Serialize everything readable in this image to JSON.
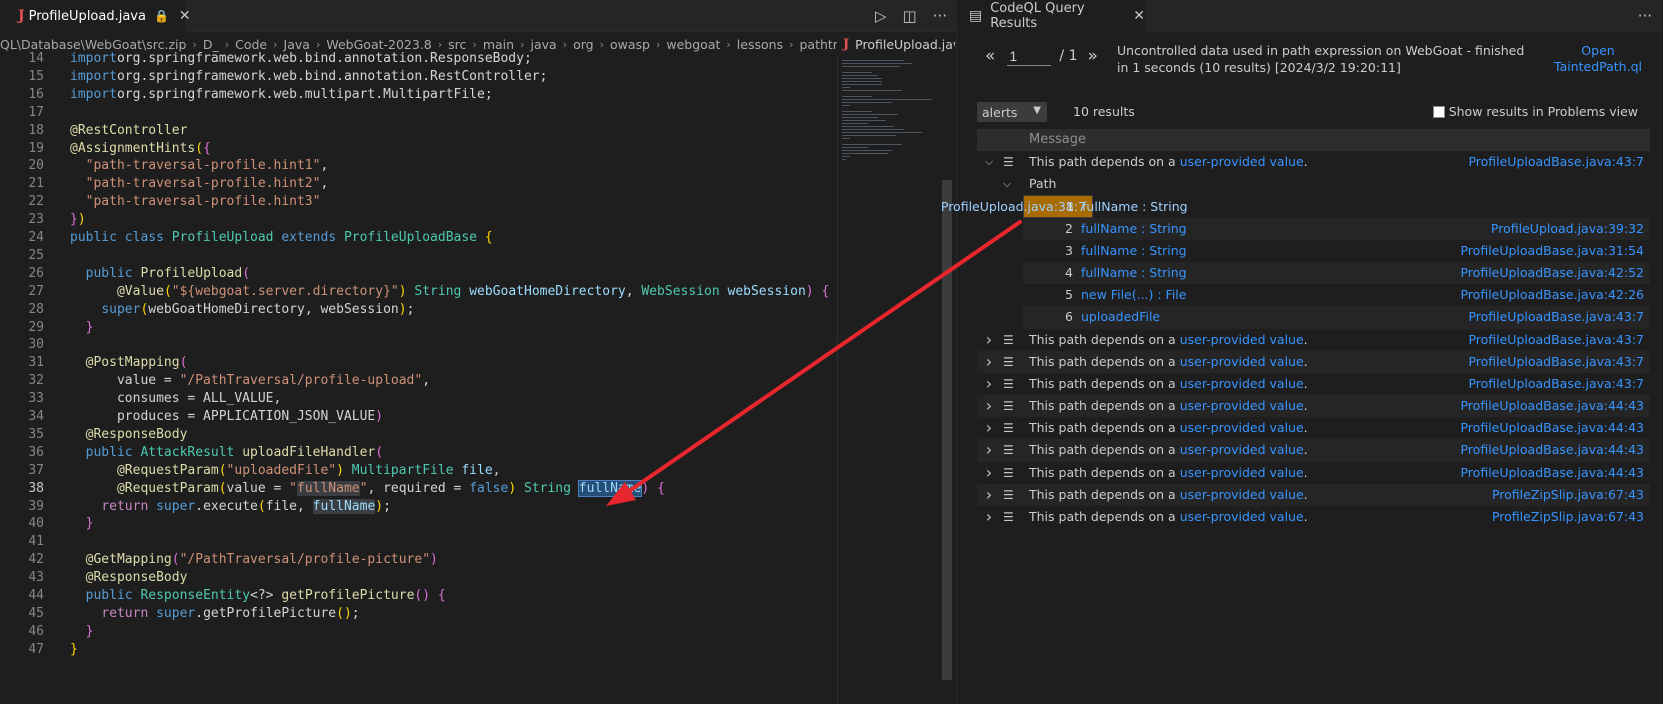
{
  "editor": {
    "tab": {
      "icon": "J",
      "name": "ProfileUpload.java"
    },
    "breadcrumb": [
      "QL\\Database\\WebGoat\\src.zip",
      "D_",
      "Code",
      "Java",
      "WebGoat-2023.8",
      "src",
      "main",
      "java",
      "org",
      "owasp",
      "webgoat",
      "lessons",
      "pathtraversal"
    ],
    "minimap_tab": {
      "icon": "J",
      "name": "ProfileUpload.java"
    },
    "active_line": "38",
    "lines": [
      {
        "n": "14",
        "code": [
          [
            "kw",
            "import"
          ],
          [
            "",
            "org.springframework.web.bind.annotation.ResponseBody;"
          ]
        ]
      },
      {
        "n": "15",
        "code": [
          [
            "kw",
            "import"
          ],
          [
            "",
            "org.springframework.web.bind.annotation.RestController;"
          ]
        ]
      },
      {
        "n": "16",
        "code": [
          [
            "kw",
            "import"
          ],
          [
            "",
            "org.springframework.web.multipart.MultipartFile;"
          ]
        ]
      },
      {
        "n": "17",
        "code": []
      },
      {
        "n": "18",
        "code": [
          [
            "an",
            "@RestController"
          ]
        ]
      },
      {
        "n": "19",
        "code": [
          [
            "an",
            "@AssignmentHints"
          ],
          [
            "pu",
            "("
          ],
          [
            "pu2",
            "{"
          ]
        ]
      },
      {
        "n": "20",
        "code": [
          [
            "",
            "  "
          ],
          [
            "st",
            "\"path-traversal-profile.hint1\""
          ],
          [
            "",
            ","
          ]
        ]
      },
      {
        "n": "21",
        "code": [
          [
            "",
            "  "
          ],
          [
            "st",
            "\"path-traversal-profile.hint2\""
          ],
          [
            "",
            ","
          ]
        ]
      },
      {
        "n": "22",
        "code": [
          [
            "",
            "  "
          ],
          [
            "st",
            "\"path-traversal-profile.hint3\""
          ]
        ]
      },
      {
        "n": "23",
        "code": [
          [
            "pu2",
            "}"
          ],
          [
            "pu",
            ")"
          ]
        ]
      },
      {
        "n": "24",
        "code": [
          [
            "kw",
            "public class "
          ],
          [
            "ty",
            "ProfileUpload "
          ],
          [
            "kw",
            "extends "
          ],
          [
            "ty",
            "ProfileUploadBase "
          ],
          [
            "pu",
            "{"
          ]
        ]
      },
      {
        "n": "25",
        "code": []
      },
      {
        "n": "26",
        "code": [
          [
            "",
            "  "
          ],
          [
            "kw",
            "public "
          ],
          [
            "fn",
            "ProfileUpload"
          ],
          [
            "pu2",
            "("
          ]
        ]
      },
      {
        "n": "27",
        "code": [
          [
            "",
            "      "
          ],
          [
            "an",
            "@Value"
          ],
          [
            "pu",
            "("
          ],
          [
            "st",
            "\"${webgoat.server.directory}\""
          ],
          [
            "pu",
            ")"
          ],
          [
            "ty",
            " String "
          ],
          [
            "vr",
            "webGoatHomeDirectory"
          ],
          [
            "",
            ", "
          ],
          [
            "ty",
            "WebSession "
          ],
          [
            "vr",
            "webSession"
          ],
          [
            "pu2",
            ")"
          ],
          [
            "",
            " "
          ],
          [
            "pu2",
            "{"
          ]
        ]
      },
      {
        "n": "28",
        "code": [
          [
            "",
            "    "
          ],
          [
            "kw",
            "super"
          ],
          [
            "pu",
            "("
          ],
          [
            "",
            "webGoatHomeDirectory, webSession"
          ],
          [
            "pu",
            ")"
          ],
          [
            "",
            ";"
          ]
        ]
      },
      {
        "n": "29",
        "code": [
          [
            "",
            "  "
          ],
          [
            "pu2",
            "}"
          ]
        ]
      },
      {
        "n": "30",
        "code": []
      },
      {
        "n": "31",
        "code": [
          [
            "",
            "  "
          ],
          [
            "an",
            "@PostMapping"
          ],
          [
            "pu2",
            "("
          ]
        ]
      },
      {
        "n": "32",
        "code": [
          [
            "",
            "      value = "
          ],
          [
            "st",
            "\"/PathTraversal/profile-upload\""
          ],
          [
            "",
            ","
          ]
        ]
      },
      {
        "n": "33",
        "code": [
          [
            "",
            "      consumes = ALL_VALUE,"
          ]
        ]
      },
      {
        "n": "34",
        "code": [
          [
            "",
            "      produces = APPLICATION_JSON_VALUE"
          ],
          [
            "pu2",
            ")"
          ]
        ]
      },
      {
        "n": "35",
        "code": [
          [
            "",
            "  "
          ],
          [
            "an",
            "@ResponseBody"
          ]
        ]
      },
      {
        "n": "36",
        "code": [
          [
            "",
            "  "
          ],
          [
            "kw",
            "public "
          ],
          [
            "ty",
            "AttackResult "
          ],
          [
            "fn",
            "uploadFileHandler"
          ],
          [
            "pu2",
            "("
          ]
        ]
      },
      {
        "n": "37",
        "code": [
          [
            "",
            "      "
          ],
          [
            "an",
            "@RequestParam"
          ],
          [
            "pu",
            "("
          ],
          [
            "st",
            "\"uploadedFile\""
          ],
          [
            "pu",
            ")"
          ],
          [
            "ty",
            " MultipartFile "
          ],
          [
            "vr",
            "file"
          ],
          [
            "",
            ","
          ]
        ]
      },
      {
        "n": "38",
        "code": [
          [
            "",
            "      "
          ],
          [
            "an",
            "@RequestParam"
          ],
          [
            "pu",
            "("
          ],
          [
            "",
            "value = "
          ],
          [
            "st",
            "\""
          ],
          [
            "st hl",
            "fullName"
          ],
          [
            "st",
            "\""
          ],
          [
            "",
            ", required = "
          ],
          [
            "kw",
            "false"
          ],
          [
            "pu",
            ")"
          ],
          [
            "ty",
            " String "
          ],
          [
            "vr hl2",
            "fullName"
          ],
          [
            "pu2",
            ")"
          ],
          [
            "",
            " "
          ],
          [
            "pu2",
            "{"
          ]
        ]
      },
      {
        "n": "39",
        "code": [
          [
            "",
            "    "
          ],
          [
            "ctl",
            "return "
          ],
          [
            "kw",
            "super"
          ],
          [
            "",
            ".execute"
          ],
          [
            "pu",
            "("
          ],
          [
            "",
            "file, "
          ],
          [
            "vr hl",
            "fullName"
          ],
          [
            "pu",
            ")"
          ],
          [
            "",
            ";"
          ]
        ]
      },
      {
        "n": "40",
        "code": [
          [
            "",
            "  "
          ],
          [
            "pu2",
            "}"
          ]
        ]
      },
      {
        "n": "41",
        "code": []
      },
      {
        "n": "42",
        "code": [
          [
            "",
            "  "
          ],
          [
            "an",
            "@GetMapping"
          ],
          [
            "pu2",
            "("
          ],
          [
            "st",
            "\"/PathTraversal/profile-picture\""
          ],
          [
            "pu2",
            ")"
          ]
        ]
      },
      {
        "n": "43",
        "code": [
          [
            "",
            "  "
          ],
          [
            "an",
            "@ResponseBody"
          ]
        ]
      },
      {
        "n": "44",
        "code": [
          [
            "",
            "  "
          ],
          [
            "kw",
            "public "
          ],
          [
            "ty",
            "ResponseEntity"
          ],
          [
            "",
            "<?> "
          ],
          [
            "fn",
            "getProfilePicture"
          ],
          [
            "pu2",
            "()"
          ],
          [
            "",
            " "
          ],
          [
            "pu2",
            "{"
          ]
        ]
      },
      {
        "n": "45",
        "code": [
          [
            "",
            "    "
          ],
          [
            "ctl",
            "return "
          ],
          [
            "kw",
            "super"
          ],
          [
            "",
            ".getProfilePicture"
          ],
          [
            "pu",
            "()"
          ],
          [
            "",
            ";"
          ]
        ]
      },
      {
        "n": "46",
        "code": [
          [
            "",
            "  "
          ],
          [
            "pu2",
            "}"
          ]
        ]
      },
      {
        "n": "47",
        "code": [
          [
            "pu",
            "}"
          ]
        ]
      }
    ]
  },
  "panel": {
    "tab_title": "CodeQL Query Results",
    "page_current": "1",
    "page_total": "/ 1",
    "summary": "Uncontrolled data used in path expression on WebGoat - finished in 1 seconds (10 results) [2024/3/2 19:20:11]",
    "open_link": "Open TaintedPath.ql",
    "select_value": "alerts",
    "result_count": "10 results",
    "show_problems_label": "Show results in Problems view",
    "header_message": "Message",
    "msg_prefix": "This path depends on a ",
    "msg_link": "user-provided value",
    "msg_suffix": ".",
    "expanded_location": "ProfileUploadBase.java:43:7",
    "path_label": "Path",
    "steps": [
      {
        "i": "1",
        "name": "fullName : String",
        "loc": "ProfileUpload.java:38:7"
      },
      {
        "i": "2",
        "name": "fullName : String",
        "loc": "ProfileUpload.java:39:32"
      },
      {
        "i": "3",
        "name": "fullName : String",
        "loc": "ProfileUploadBase.java:31:54"
      },
      {
        "i": "4",
        "name": "fullName : String",
        "loc": "ProfileUploadBase.java:42:52"
      },
      {
        "i": "5",
        "name": "new File(...) : File",
        "loc": "ProfileUploadBase.java:42:26"
      },
      {
        "i": "6",
        "name": "uploadedFile",
        "loc": "ProfileUploadBase.java:43:7"
      }
    ],
    "collapsed_locations": [
      "ProfileUploadBase.java:43:7",
      "ProfileUploadBase.java:43:7",
      "ProfileUploadBase.java:43:7",
      "ProfileUploadBase.java:44:43",
      "ProfileUploadBase.java:44:43",
      "ProfileUploadBase.java:44:43",
      "ProfileUploadBase.java:44:43",
      "ProfileZipSlip.java:67:43",
      "ProfileZipSlip.java:67:43"
    ]
  },
  "colors": {
    "selection": "#a86b00",
    "link": "#3794ff",
    "arrow": "#e8262d"
  },
  "icons": [
    "close-icon",
    "lock-icon",
    "run-icon",
    "split-editor-icon",
    "more-icon",
    "list-icon",
    "chevron-right-icon",
    "chevron-down-icon"
  ]
}
